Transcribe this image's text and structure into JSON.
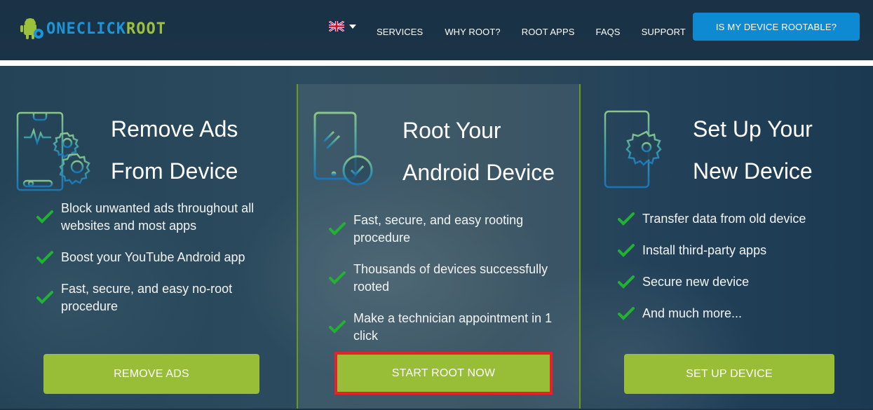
{
  "header": {
    "logo": {
      "part1": "ONECLICK",
      "part2": "ROOT",
      "icon": "android-robot-icon"
    },
    "language": {
      "selected": "English (UK)",
      "icon": "uk-flag-icon"
    },
    "nav": [
      {
        "label": "SERVICES"
      },
      {
        "label": "WHY ROOT?"
      },
      {
        "label": "ROOT APPS"
      },
      {
        "label": "FAQS"
      },
      {
        "label": "SUPPORT"
      }
    ],
    "cta_label": "IS MY DEVICE ROOTABLE?"
  },
  "cards": [
    {
      "icon": "phone-equalizer-gears-icon",
      "title_line1": "Remove Ads",
      "title_line2": "From Device",
      "features": [
        "Block unwanted ads throughout all websites and most apps",
        "Boost your YouTube Android app",
        "Fast, secure, and easy no-root procedure"
      ],
      "button_label": "REMOVE ADS"
    },
    {
      "icon": "phone-checkmark-icon",
      "title_line1": "Root Your",
      "title_line2": "Android Device",
      "features": [
        "Fast, secure, and easy rooting procedure",
        "Thousands of devices successfully rooted",
        "Make a technician appointment in 1 click"
      ],
      "button_label": "START ROOT NOW",
      "highlighted": true
    },
    {
      "icon": "phone-gear-icon",
      "title_line1": "Set Up Your",
      "title_line2": "New Device",
      "features": [
        "Transfer data from old device",
        "Install third-party apps",
        "Secure new device",
        "And much more..."
      ],
      "button_label": "SET UP DEVICE"
    }
  ],
  "colors": {
    "header_bg": "#1b3347",
    "accent_green": "#98bd36",
    "cta_blue": "#0e8ad2",
    "highlight_red": "#e8202a",
    "check_green": "#22b233"
  }
}
